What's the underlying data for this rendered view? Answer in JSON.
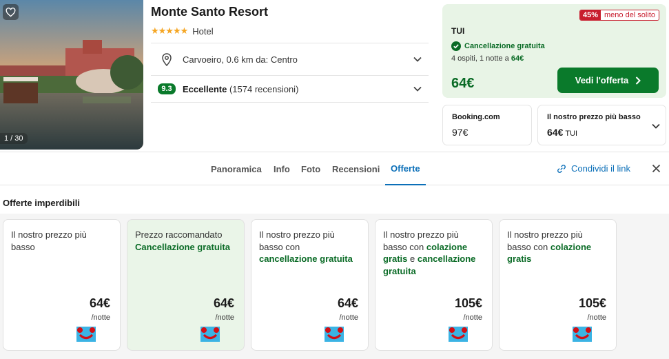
{
  "hotel": {
    "name": "Monte Santo Resort",
    "stars": "★★★★★",
    "type": "Hotel",
    "photo_counter": "1 / 30",
    "location": "Carvoeiro, 0.6 km da: Centro",
    "score": "9.3",
    "score_label": "Eccellente",
    "reviews": "(1574 recensioni)"
  },
  "deal": {
    "discount": "45%",
    "discount_text": "meno del solito",
    "provider": "TUI",
    "cancellation": "Cancellazione gratuita",
    "guests_text": "4 ospiti, 1 notte a ",
    "guests_price": "64€",
    "price": "64€",
    "cta": "Vedi l'offerta"
  },
  "alternatives": [
    {
      "label": "Booking.com",
      "price": "97€",
      "sub": ""
    },
    {
      "label": "Il nostro prezzo più basso",
      "price": "64€",
      "sub": "TUI"
    }
  ],
  "tabs": [
    "Panoramica",
    "Info",
    "Foto",
    "Recensioni",
    "Offerte"
  ],
  "active_tab": "Offerte",
  "share_label": "Condividi il link",
  "offers_title": "Offerte imperdibili",
  "offers": [
    {
      "line1": "Il nostro prezzo più basso",
      "price": "64€",
      "per": "/notte"
    },
    {
      "line1": "Prezzo raccomandato",
      "highlight": "Cancellazione gratuita",
      "price": "64€",
      "per": "/notte"
    },
    {
      "line1": "Il nostro prezzo più basso con",
      "highlight": "cancellazione gratuita",
      "price": "64€",
      "per": "/notte"
    },
    {
      "line1": "Il nostro prezzo più basso con",
      "highlight": "colazione gratis",
      "joiner": " e ",
      "highlight2": "cancellazione gratuita",
      "price": "105€",
      "per": "/notte"
    },
    {
      "line1": "Il nostro prezzo più basso con",
      "highlight": "colazione gratis",
      "price": "105€",
      "per": "/notte"
    }
  ],
  "colors": {
    "green": "#0a7a2b",
    "blue": "#0b6fb8",
    "red": "#c81d2e",
    "star": "#f5a623",
    "tui": "#3bb3e4"
  },
  "icons": [
    "heart-icon",
    "location-pin-icon",
    "chevron-down-icon",
    "check-circle-icon",
    "chevron-right-icon",
    "link-icon",
    "close-icon",
    "tui-logo"
  ]
}
